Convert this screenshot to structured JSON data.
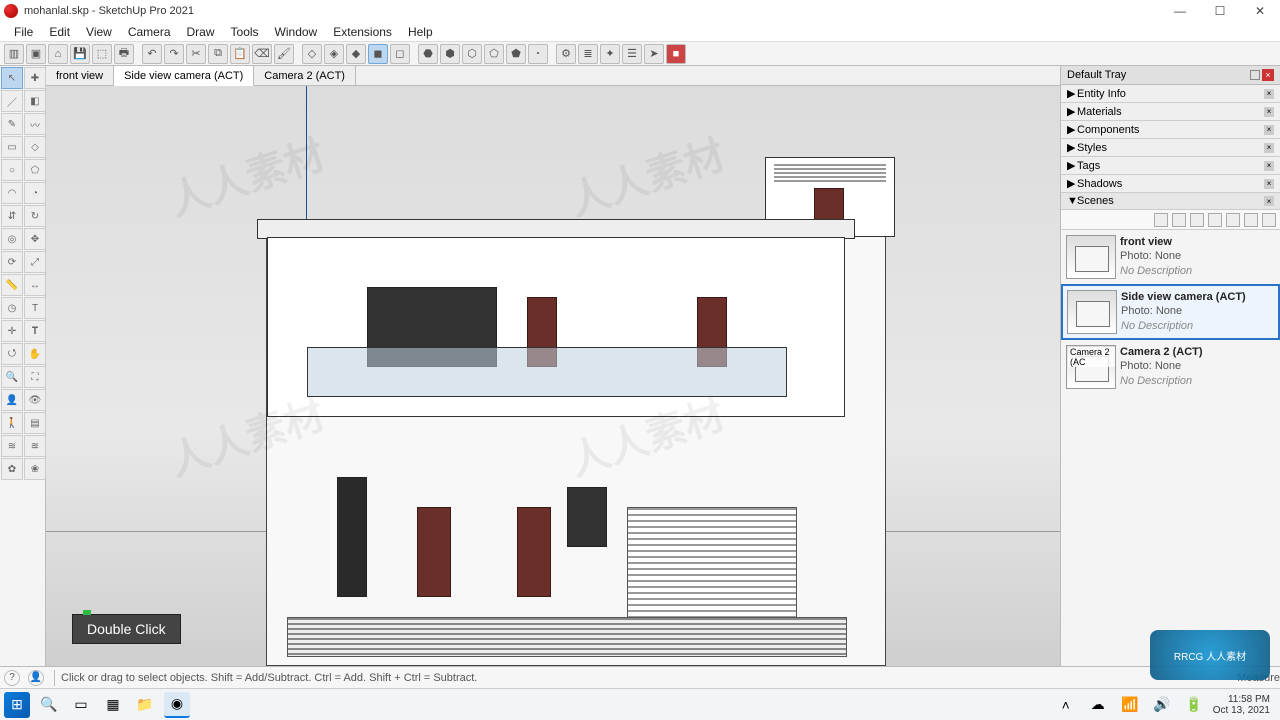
{
  "title": "mohanlal.skp - SketchUp Pro 2021",
  "window_buttons": {
    "min": "—",
    "max": "☐",
    "close": "✕"
  },
  "menus": [
    "File",
    "Edit",
    "View",
    "Camera",
    "Draw",
    "Tools",
    "Window",
    "Extensions",
    "Help"
  ],
  "scene_tabs": [
    {
      "label": "front view",
      "active": false
    },
    {
      "label": "Side view camera (ACT)",
      "active": true
    },
    {
      "label": "Camera 2 (ACT)",
      "active": false
    }
  ],
  "tooltip": "Double Click",
  "tray": {
    "title": "Default Tray",
    "panels": [
      {
        "label": "Entity Info",
        "expanded": false
      },
      {
        "label": "Materials",
        "expanded": false
      },
      {
        "label": "Components",
        "expanded": false
      },
      {
        "label": "Styles",
        "expanded": false
      },
      {
        "label": "Tags",
        "expanded": false
      },
      {
        "label": "Shadows",
        "expanded": false
      },
      {
        "label": "Scenes",
        "expanded": true
      }
    ]
  },
  "scenes": [
    {
      "name": "front view",
      "photo": "Photo: None",
      "desc": "No Description",
      "active": false,
      "overlay": ""
    },
    {
      "name": "Side view camera (ACT)",
      "photo": "Photo: None",
      "desc": "No Description",
      "active": true,
      "overlay": ""
    },
    {
      "name": "Camera 2 (ACT)",
      "photo": "Photo: None",
      "desc": "No Description",
      "active": false,
      "overlay": "Camera 2 (AC"
    }
  ],
  "status": {
    "hint": "Click or drag to select objects. Shift = Add/Subtract. Ctrl = Add. Shift + Ctrl = Subtract.",
    "measure_label": "Measure"
  },
  "taskbar": {
    "time": "11:58 PM",
    "date": "Oct 13, 2021"
  },
  "brand_badge": "RRCG 人人素材"
}
